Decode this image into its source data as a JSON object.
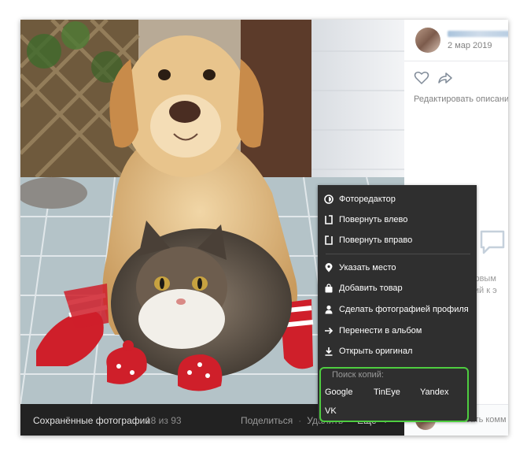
{
  "bottom_bar": {
    "album": "Сохранённые фотографии",
    "counter": "18 из 93",
    "share": "Поделиться",
    "delete": "Удалить",
    "separator": "·",
    "more": "Ещё"
  },
  "sidebar": {
    "date": "2 мар 2019",
    "edit_description": "Редактировать описани",
    "hint_line1": "дьте первым",
    "hint_line2": "ментарий к э",
    "comment_placeholder": "Написать комм"
  },
  "menu": {
    "items": [
      {
        "label": "Фоторедактор",
        "icon": "photo-editor-icon"
      },
      {
        "label": "Повернуть влево",
        "icon": "rotate-left-icon"
      },
      {
        "label": "Повернуть вправо",
        "icon": "rotate-right-icon"
      },
      {
        "label": "Указать место",
        "icon": "location-pin-icon"
      },
      {
        "label": "Добавить товар",
        "icon": "shopping-bag-icon"
      },
      {
        "label": "Сделать фотографией профиля",
        "icon": "user-icon"
      },
      {
        "label": "Перенести в альбом",
        "icon": "arrow-right-icon"
      },
      {
        "label": "Открыть оригинал",
        "icon": "download-icon"
      }
    ],
    "copy_search": {
      "title": "Поиск копий:",
      "engines": [
        "Google",
        "TinEye",
        "Yandex",
        "VK"
      ]
    }
  },
  "colors": {
    "menu_bg": "#2f2f2f",
    "bottom_bar_bg": "#222222",
    "highlight": "#4ecd40"
  }
}
